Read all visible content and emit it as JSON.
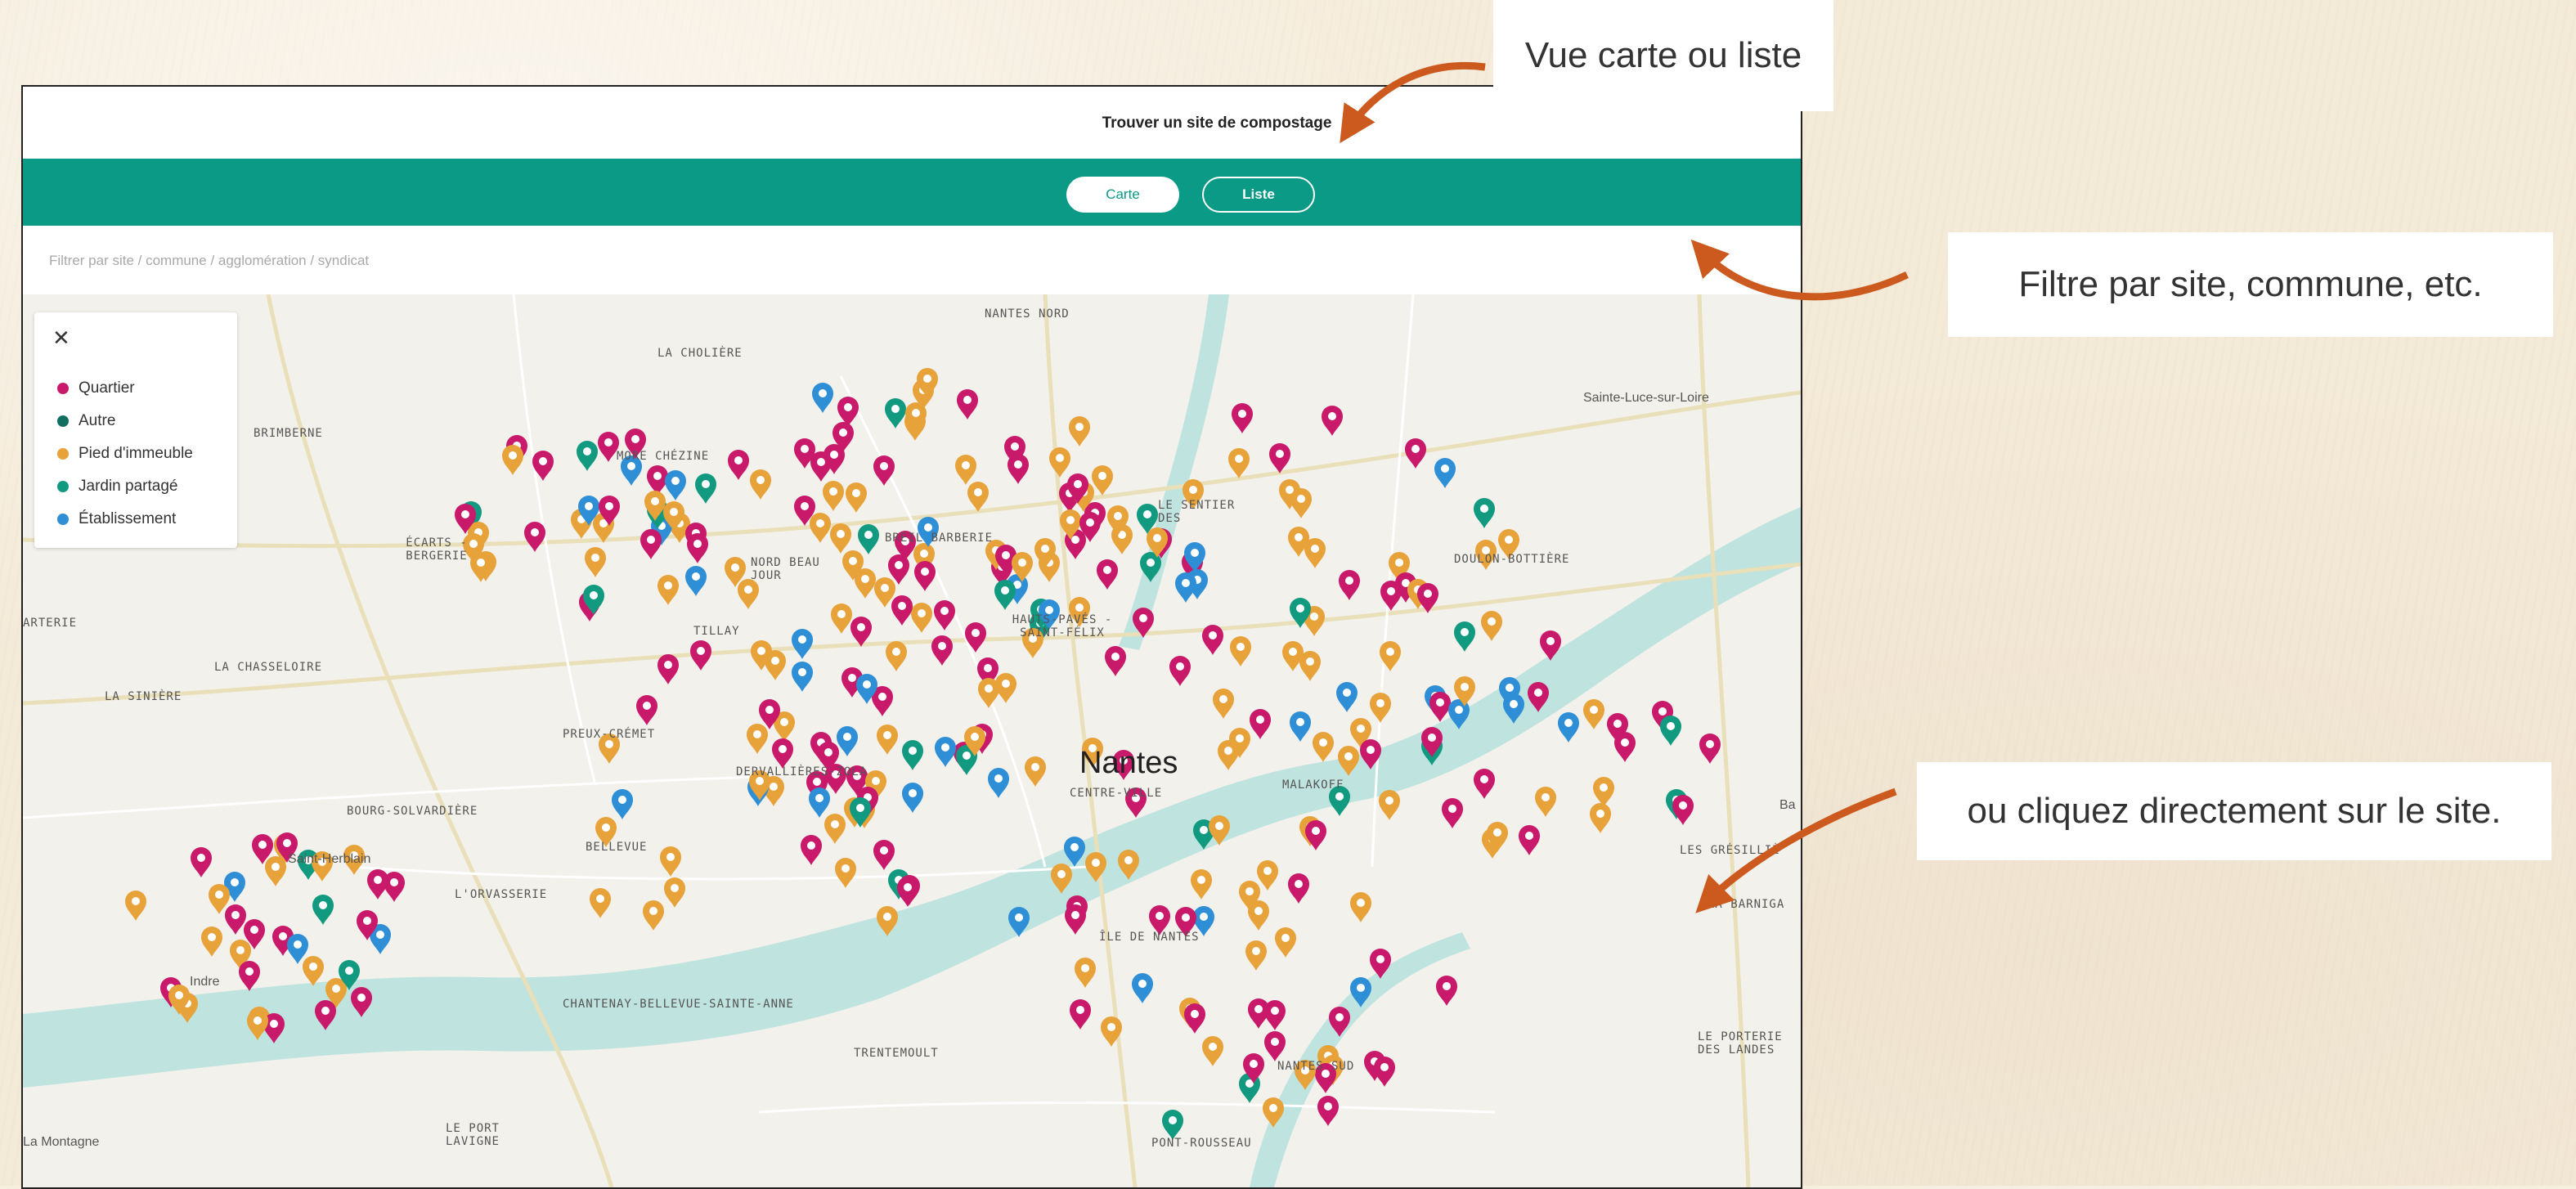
{
  "colors": {
    "accent_green": "#0b9a86",
    "arrow": "#cc5a1e",
    "quartier": "#c8196a",
    "autre": "#106f60",
    "pied": "#e8a23a",
    "jardin": "#129a80",
    "etab": "#2e8fd6"
  },
  "app": {
    "title": "Trouver un site de compostage",
    "toggle": {
      "map": "Carte",
      "list": "Liste",
      "selected": "Carte"
    },
    "filter_placeholder": "Filtrer par site / commune / agglomération / syndicat"
  },
  "legend": {
    "close": "✕",
    "items": [
      {
        "label": "Quartier",
        "color": "#c8196a"
      },
      {
        "label": "Autre",
        "color": "#106f60"
      },
      {
        "label": "Pied d'immeuble",
        "color": "#e8a23a"
      },
      {
        "label": "Jardin partagé",
        "color": "#129a80"
      },
      {
        "label": "Établissement",
        "color": "#2e8fd6"
      }
    ]
  },
  "map": {
    "city": "Nantes",
    "labels": {
      "nantes_nord": "NANTES NORD",
      "la_cholliere": "LA CHOLIÈRE",
      "brimberne": "BRIMBERNE",
      "moree_chezine": "MORE CHÉZINE",
      "ecarts_bergerie": "ÉCARTS - BERGERIE",
      "nord_beau_jour": "NORD BEAU JOUR",
      "breil_barberie": "BREIL BARBERIE",
      "tillay": "TILLAY",
      "la_chasseloire": "LA CHASSELOIRE",
      "la_siniere": "LA SINIÈRE",
      "arterie": "ARTERIE",
      "le_sentier": "LE SENTIER DES",
      "hauts_paves": "HAUTS-PAVÉS - SAINT-FÉLIX",
      "doulon": "DOULON-BOTTIÈRE",
      "sainte_luce": "Sainte-Luce-sur-Loire",
      "preux_cremet": "PREUX-CRÉMET",
      "dervallieres": "DERVALLIÈRES-ZOLA",
      "centre_ville": "CENTRE-VILLE",
      "malakoff": "MALAKOFF",
      "bourg_solvardiere": "BOURG-SOLVARDIÈRE",
      "saint_herblain": "Saint-Herblain",
      "bellevue": "BELLEVUE",
      "lorvasserie": "L'ORVASSERIE",
      "ile_de_nantes": "ÎLE DE NANTES",
      "les_gresillieres": "LES GRÉSILLIÈ",
      "la_barniga": "LA BARNIGA",
      "chantenay": "CHANTENAY-BELLEVUE-SAINTE-ANNE",
      "trentemoult": "TRENTEMOULT",
      "indre": "Indre",
      "nantes_sud": "NANTES SUD",
      "le_pont_rousseau": "PONT-ROUSSEAU",
      "le_port_lavigne": "LE PORT LAVIGNE",
      "la_montagne": "La Montagne",
      "le_porterie": "LE PORTERIE DES LANDES",
      "ba": "Ba"
    }
  },
  "annotations": {
    "map_list_view": "Vue carte ou liste",
    "filter_hint": "Filtre par site, commune, etc.",
    "click_hint": "ou cliquez directement sur le site."
  }
}
